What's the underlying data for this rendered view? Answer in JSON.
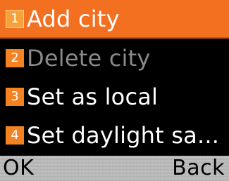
{
  "menu": {
    "items": [
      {
        "number": "1",
        "label": "Add city",
        "selected": true,
        "enabled": true
      },
      {
        "number": "2",
        "label": "Delete city",
        "selected": false,
        "enabled": false
      },
      {
        "number": "3",
        "label": "Set as local",
        "selected": false,
        "enabled": true
      },
      {
        "number": "4",
        "label": "Set daylight sa...",
        "selected": false,
        "enabled": true
      }
    ]
  },
  "softkeys": {
    "left": "OK",
    "right": "Back"
  },
  "colors": {
    "highlight": "#f37020",
    "badge": "#f58220",
    "disabled_text": "#8a8a8a",
    "softbar": "#bdbdbd"
  }
}
